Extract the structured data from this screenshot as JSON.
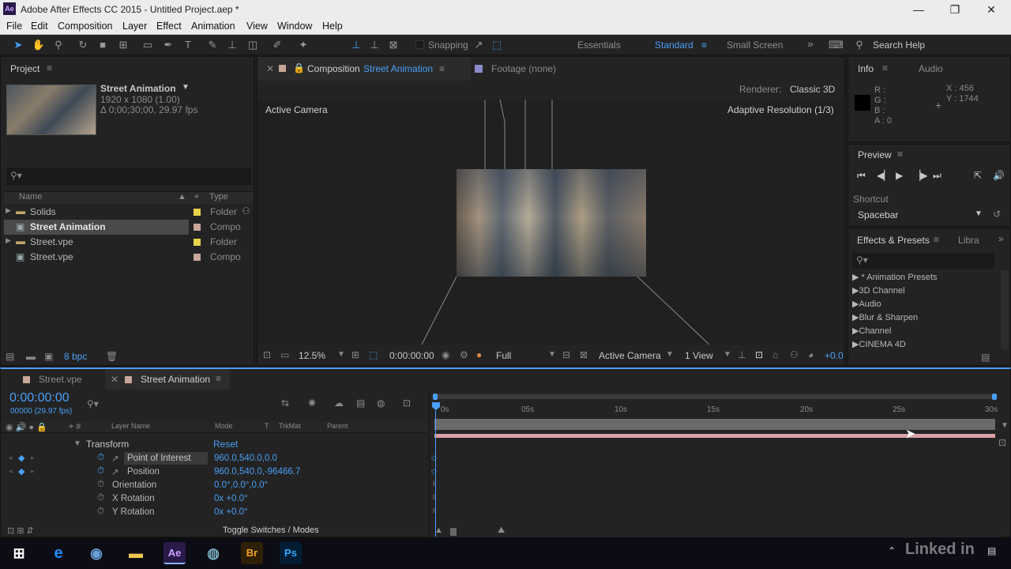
{
  "window": {
    "title": "Adobe After Effects CC 2015 - Untitled Project.aep *",
    "app_badge": "Ae",
    "min": "—",
    "max": "❐",
    "close": "✕"
  },
  "menu": [
    "File",
    "Edit",
    "Composition",
    "Layer",
    "Effect",
    "Animation",
    "View",
    "Window",
    "Help"
  ],
  "toolbar": {
    "snapping": "Snapping",
    "workspaces": [
      "Essentials",
      "Standard",
      "Small Screen"
    ],
    "search_help": "Search Help",
    "chevrons": "»"
  },
  "project": {
    "title": "Project",
    "comp_name": "Street Animation",
    "dims": "1920 x 1080 (1.00)",
    "duration": "Δ 0;00;30;00, 29.97 fps",
    "col_name": "Name",
    "col_type": "Type",
    "bpc": "8 bpc",
    "items": [
      {
        "name": "Solids",
        "type": "Folder",
        "color": "#e8d24a",
        "kind": "folder"
      },
      {
        "name": "Street Animation",
        "type": "Compo",
        "color": "#c9a59a",
        "kind": "comp"
      },
      {
        "name": "Street.vpe",
        "type": "Folder",
        "color": "#e8d24a",
        "kind": "folder"
      },
      {
        "name": "Street.vpe",
        "type": "Compo",
        "color": "#c9a59a",
        "kind": "comp"
      }
    ]
  },
  "viewer": {
    "tab_prefix": "Composition",
    "tab_comp": "Street Animation",
    "footage": "Footage (none)",
    "renderer_label": "Renderer:",
    "renderer": "Classic 3D",
    "active_camera": "Active Camera",
    "adaptive": "Adaptive Resolution (1/3)",
    "zoom": "12.5%",
    "time": "0:00:00:00",
    "res": "Full",
    "camera_sel": "Active Camera",
    "view": "1 View",
    "exposure": "+0.0"
  },
  "info": {
    "title": "Info",
    "audio": "Audio",
    "r": "R :",
    "g": "G :",
    "b": "B :",
    "a": "A : 0",
    "x": "X : 456",
    "y": "Y : 1744"
  },
  "preview": {
    "title": "Preview",
    "shortcut_label": "Shortcut",
    "shortcut": "Spacebar"
  },
  "effects": {
    "title": "Effects & Presets",
    "libra": "Libra",
    "items": [
      "* Animation Presets",
      "3D Channel",
      "Audio",
      "Blur & Sharpen",
      "Channel",
      "CINEMA 4D"
    ]
  },
  "timeline": {
    "tab1": "Street.vpe",
    "tab2": "Street Animation",
    "timecode": "0:00:00:00",
    "fps": "00000 (29.97 fps)",
    "col_layer": "Layer Name",
    "col_mode": "Mode",
    "col_t": "T",
    "col_trkmat": "TrkMat",
    "col_parent": "Parent",
    "transform": "Transform",
    "reset": "Reset",
    "toggle": "Toggle Switches / Modes",
    "props": [
      {
        "name": "Point of Interest",
        "value": "960.0,540.0,0.0"
      },
      {
        "name": "Position",
        "value": "960.0,540.0,-96466.7"
      },
      {
        "name": "Orientation",
        "value": "0.0°,0.0°,0.0°"
      },
      {
        "name": "X Rotation",
        "value": "0x +0.0°"
      },
      {
        "name": "Y Rotation",
        "value": "0x +0.0°"
      }
    ],
    "ruler": [
      "0s",
      "05s",
      "10s",
      "15s",
      "20s",
      "25s",
      "30s"
    ]
  },
  "watermark": "Linked in",
  "colors": {
    "accent": "#4a9ff5",
    "bg": "#232323",
    "workarea": "#6a6a6a"
  }
}
